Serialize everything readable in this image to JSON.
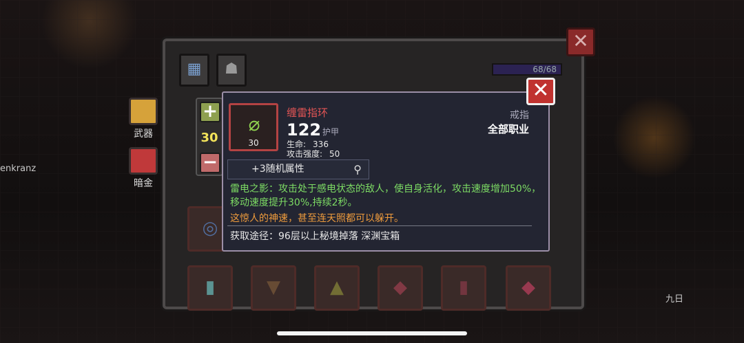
{
  "background": {
    "left_player_name": "enkranz",
    "right_player_name": "九日",
    "side_buttons": [
      {
        "label": "武器",
        "icon": "weapon-chest-icon",
        "color": "#d6a23a"
      },
      {
        "label": "暗金",
        "icon": "gold-chest-icon",
        "color": "#c0393a"
      }
    ]
  },
  "inventory": {
    "capacity": "68/68",
    "tabs": [
      {
        "icon": "grid-category-icon"
      },
      {
        "icon": "armor-category-icon"
      }
    ],
    "close_symbol": "✕"
  },
  "stepper": {
    "plus": "+",
    "minus": "−",
    "value": "30"
  },
  "item": {
    "name": "缠雷指环",
    "level": "30",
    "armor_value": "122",
    "armor_label": "护甲",
    "stats": [
      {
        "label": "生命:",
        "value": "336"
      },
      {
        "label": "攻击强度:",
        "value": "50"
      }
    ],
    "slot_type": "戒指",
    "class_requirement": "全部职业",
    "random_attributes": "+3随机属性",
    "effect": "雷电之影：攻击处于感电状态的敌人，使自身活化，攻击速度增加50%，移动速度提升30%,持续2秒。",
    "flavor": "这惊人的神速，甚至连天照都可以躲开。",
    "source": "获取途径：96层以上秘境掉落 深渊宝箱",
    "close_symbol": "✕",
    "colors": {
      "name": "#e45555",
      "effect": "#7ddc64",
      "flavor": "#ee9b3c",
      "border_rarity": "#b44343"
    }
  }
}
